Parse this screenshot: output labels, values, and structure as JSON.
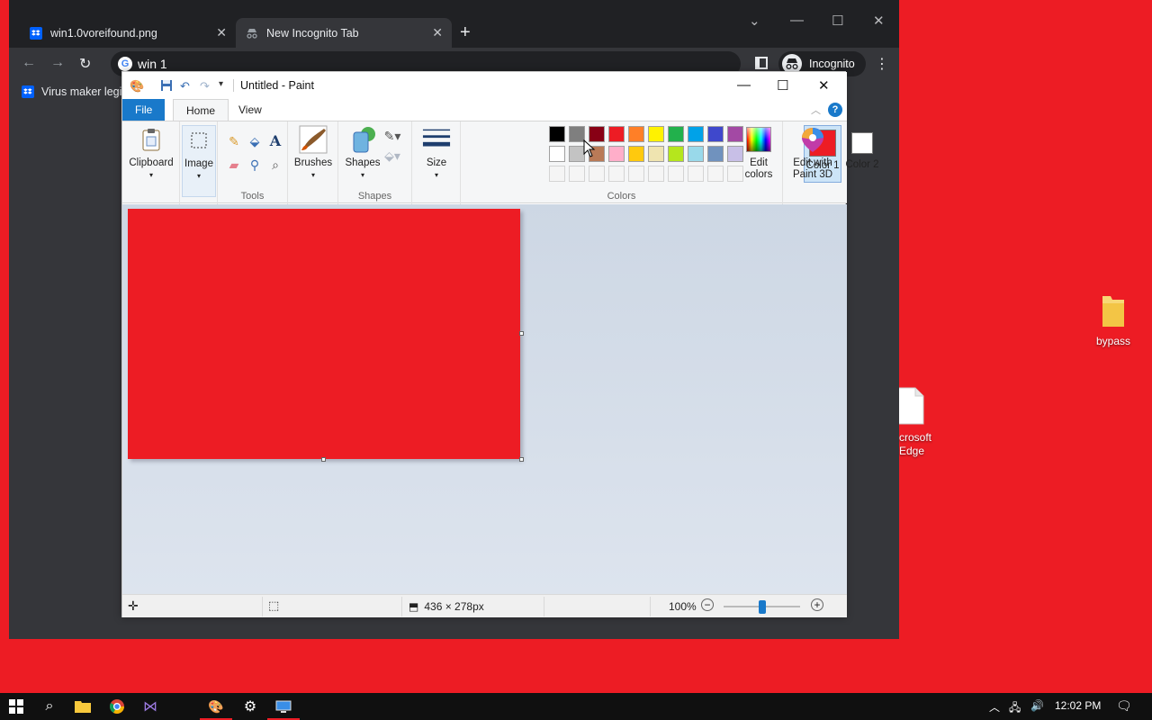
{
  "desktop": {
    "icons": [
      {
        "label": "bypass",
        "icon": "folder-icon"
      },
      {
        "label": "crosoft\nEdge",
        "icon": "file-icon"
      }
    ]
  },
  "chrome": {
    "tabs": [
      {
        "label": "win1.0voreifound.png",
        "icon": "dropbox-icon",
        "active": false
      },
      {
        "label": "New Incognito Tab",
        "icon": "incognito-icon",
        "active": true
      }
    ],
    "address": "win 1",
    "profile_label": "Incognito",
    "bookmark": "Virus maker legi"
  },
  "paint": {
    "title": "Untitled - Paint",
    "ribbon_tabs": {
      "file": "File",
      "home": "Home",
      "view": "View"
    },
    "groups": {
      "clipboard": "Clipboard",
      "image": "Image",
      "tools": "Tools",
      "brushes": "Brushes",
      "shapes_btn": "Shapes",
      "shapes": "Shapes",
      "size": "Size",
      "color1": "Color 1",
      "color2": "Color 2",
      "colors": "Colors",
      "edit_colors": "Edit colors",
      "paint3d": "Edit with Paint 3D"
    },
    "color1_value": "#ed1c24",
    "color2_value": "#ffffff",
    "palette_row1": [
      "#000000",
      "#7f7f7f",
      "#880015",
      "#ed1c24",
      "#ff7f27",
      "#fff200",
      "#22b14c",
      "#00a2e8",
      "#3f48cc",
      "#a349a4"
    ],
    "palette_row2": [
      "#ffffff",
      "#c3c3c3",
      "#b97a57",
      "#ffaec9",
      "#ffc90e",
      "#efe4b0",
      "#b5e61d",
      "#99d9ea",
      "#7092be",
      "#c8bfe7"
    ],
    "canvas_color": "#ed1c24",
    "status": {
      "image_size": "436 × 278px",
      "zoom": "100%",
      "zoom_fraction": 0.5
    }
  },
  "taskbar": {
    "time": "12:02 PM"
  }
}
